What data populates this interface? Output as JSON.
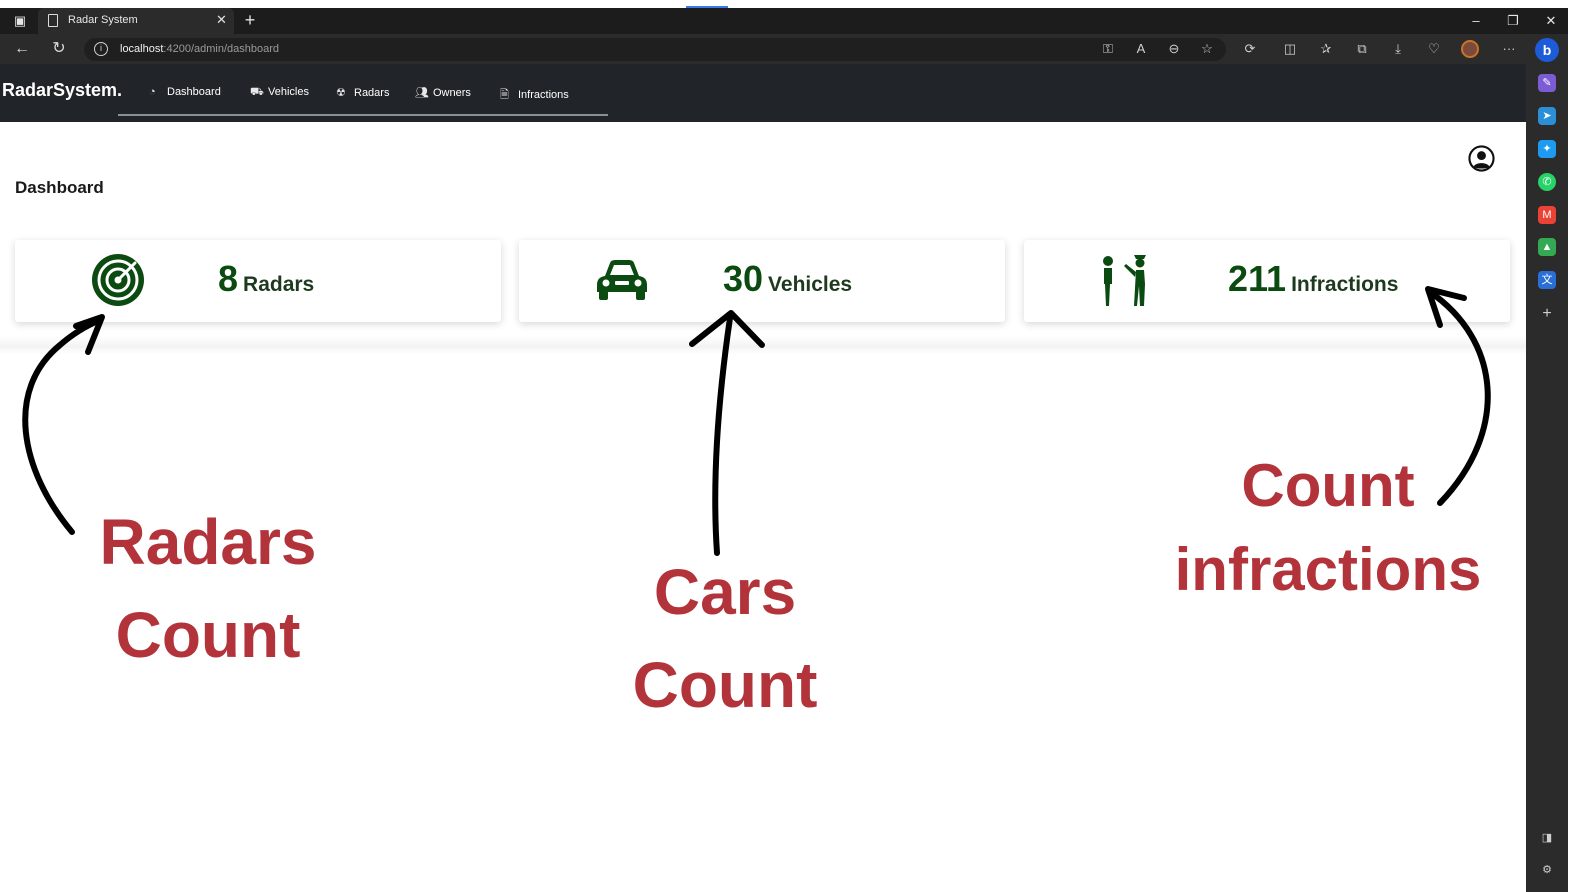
{
  "browser": {
    "tab_title": "Radar System",
    "url_host": "localhost",
    "url_path": ":4200/admin/dashboard"
  },
  "app": {
    "brand": "RadarSystem.",
    "nav": [
      {
        "label": "Dashboard",
        "icon": "gauge-icon"
      },
      {
        "label": "Vehicles",
        "icon": "car-icon"
      },
      {
        "label": "Radars",
        "icon": "radar-icon"
      },
      {
        "label": "Owners",
        "icon": "users-icon"
      },
      {
        "label": "Infractions",
        "icon": "file-icon"
      }
    ]
  },
  "page": {
    "title": "Dashboard"
  },
  "cards": [
    {
      "count": "8",
      "label": "Radars",
      "icon": "radar-icon"
    },
    {
      "count": "30",
      "label": "Vehicles",
      "icon": "car-icon"
    },
    {
      "count": "211",
      "label": "Infractions",
      "icon": "officer-ticket-icon"
    }
  ],
  "annotations": {
    "radars": [
      "Radars",
      "Count"
    ],
    "cars": [
      "Cars",
      "Count"
    ],
    "infractions": [
      "Count",
      "infractions"
    ]
  },
  "colors": {
    "accent_green": "#0b4a10",
    "annotation_red": "#b2333a",
    "navbar": "#212529"
  }
}
